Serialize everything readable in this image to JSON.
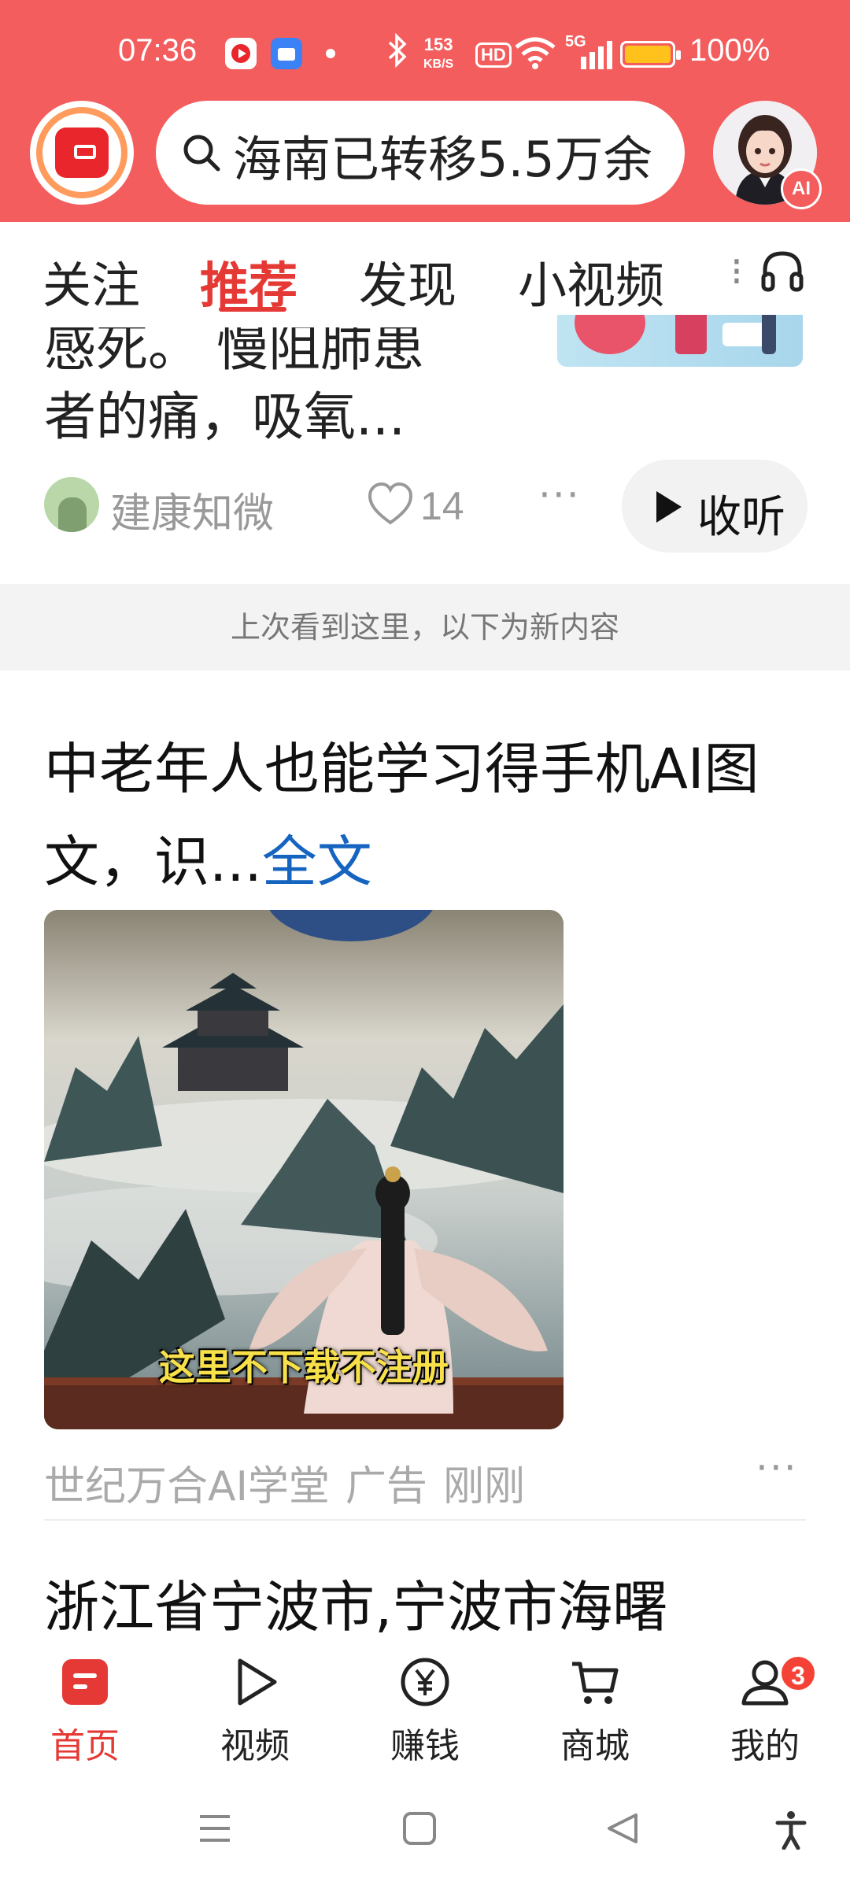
{
  "status_bar": {
    "time": "07:36",
    "network_speed_value": "153",
    "network_speed_unit": "KB/S",
    "hd_label": "HD",
    "signal_label": "5G",
    "battery": "100%",
    "battery_level": 1.0
  },
  "header": {
    "search_query": "海南已转移5.5万余",
    "avatar_badge": "AI"
  },
  "tabs": {
    "items": [
      "关注",
      "推荐",
      "发现",
      "小视频"
    ],
    "active_index": 1
  },
  "feed": {
    "article1": {
      "title_partial_top": "感死。 慢阻肺患",
      "title_line": "者的痛，吸氧...",
      "source": "建康知微",
      "likes": "14",
      "listen_label": "收听"
    },
    "notice": "上次看到这里，以下为新内容",
    "ad": {
      "title": "中老年人也能学习得手机AI图文，识...",
      "full_text_link": "全文",
      "image_caption": "这里不下载不注册",
      "advertiser": "世纪万合AI学堂",
      "ad_label": "广告",
      "time": "刚刚"
    },
    "article3": {
      "title": "浙江省宁波市,宁波市海曙"
    }
  },
  "bottom_nav": {
    "items": [
      {
        "label": "首页",
        "icon": "home-icon"
      },
      {
        "label": "视频",
        "icon": "video-play-icon"
      },
      {
        "label": "赚钱",
        "icon": "yuan-coin-icon"
      },
      {
        "label": "商城",
        "icon": "cart-icon"
      },
      {
        "label": "我的",
        "icon": "user-icon"
      }
    ],
    "active_index": 0,
    "profile_badge": "3"
  },
  "colors": {
    "header_bg": "#f35d5d",
    "accent_red": "#e53935",
    "link_blue": "#1565c0"
  }
}
